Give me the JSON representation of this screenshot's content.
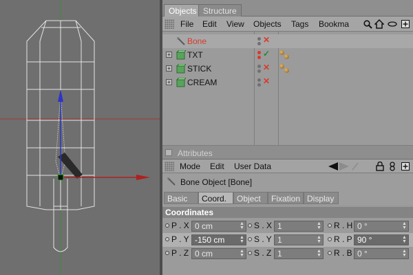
{
  "window": {
    "tabs": [
      {
        "label": "Objects"
      },
      {
        "label": "Structure"
      }
    ]
  },
  "object_manager": {
    "menu": [
      "File",
      "Edit",
      "View",
      "Objects",
      "Tags",
      "Bookma"
    ],
    "toolbar_icons": [
      "search-icon",
      "home-icon",
      "eye-icon",
      "new-panel-icon"
    ],
    "objects": [
      {
        "name": "Bone",
        "selected": true,
        "color": "#d93a2b",
        "expandable": false,
        "enabled": false
      },
      {
        "name": "TXT",
        "selected": false,
        "color": "#111111",
        "expandable": true,
        "enabled": true,
        "tags": 2
      },
      {
        "name": "STICK",
        "selected": false,
        "color": "#111111",
        "expandable": true,
        "enabled": false,
        "tags": 2
      },
      {
        "name": "CREAM",
        "selected": false,
        "color": "#111111",
        "expandable": true,
        "enabled": false,
        "tags": 0
      }
    ],
    "enabled_mark": "✓",
    "disabled_mark": "✕"
  },
  "attributes": {
    "title": "Attributes",
    "menu": [
      "Mode",
      "Edit",
      "User Data"
    ],
    "object_title": "Bone Object [Bone]",
    "tabs": [
      {
        "label": "Basic",
        "active": false
      },
      {
        "label": "Coord.",
        "active": true
      },
      {
        "label": "Object",
        "active": false
      },
      {
        "label": "Fixation",
        "active": false
      },
      {
        "label": "Display",
        "active": false
      }
    ],
    "section": "Coordinates",
    "rows": [
      {
        "highlight": false,
        "cells": [
          {
            "label": "P . X",
            "value": "0 cm"
          },
          {
            "label": "S . X",
            "value": "1"
          },
          {
            "label": "R . H",
            "value": "0 °"
          }
        ]
      },
      {
        "highlight": true,
        "cells": [
          {
            "label": "P . Y",
            "value": "-150 cm"
          },
          {
            "label": "S . Y",
            "value": "1"
          },
          {
            "label": "R . P",
            "value": "90 °"
          }
        ]
      },
      {
        "highlight": false,
        "cells": [
          {
            "label": "P . Z",
            "value": "0 cm"
          },
          {
            "label": "S . Z",
            "value": "1"
          },
          {
            "label": "R . B",
            "value": "0 °"
          }
        ]
      }
    ]
  },
  "colors": {
    "accent_red": "#d93a2b",
    "check_green": "#1f8a2a",
    "viewport_bg": "#6f6f6f",
    "axis_y": "#2c34c8",
    "axis_x": "#b02020"
  }
}
